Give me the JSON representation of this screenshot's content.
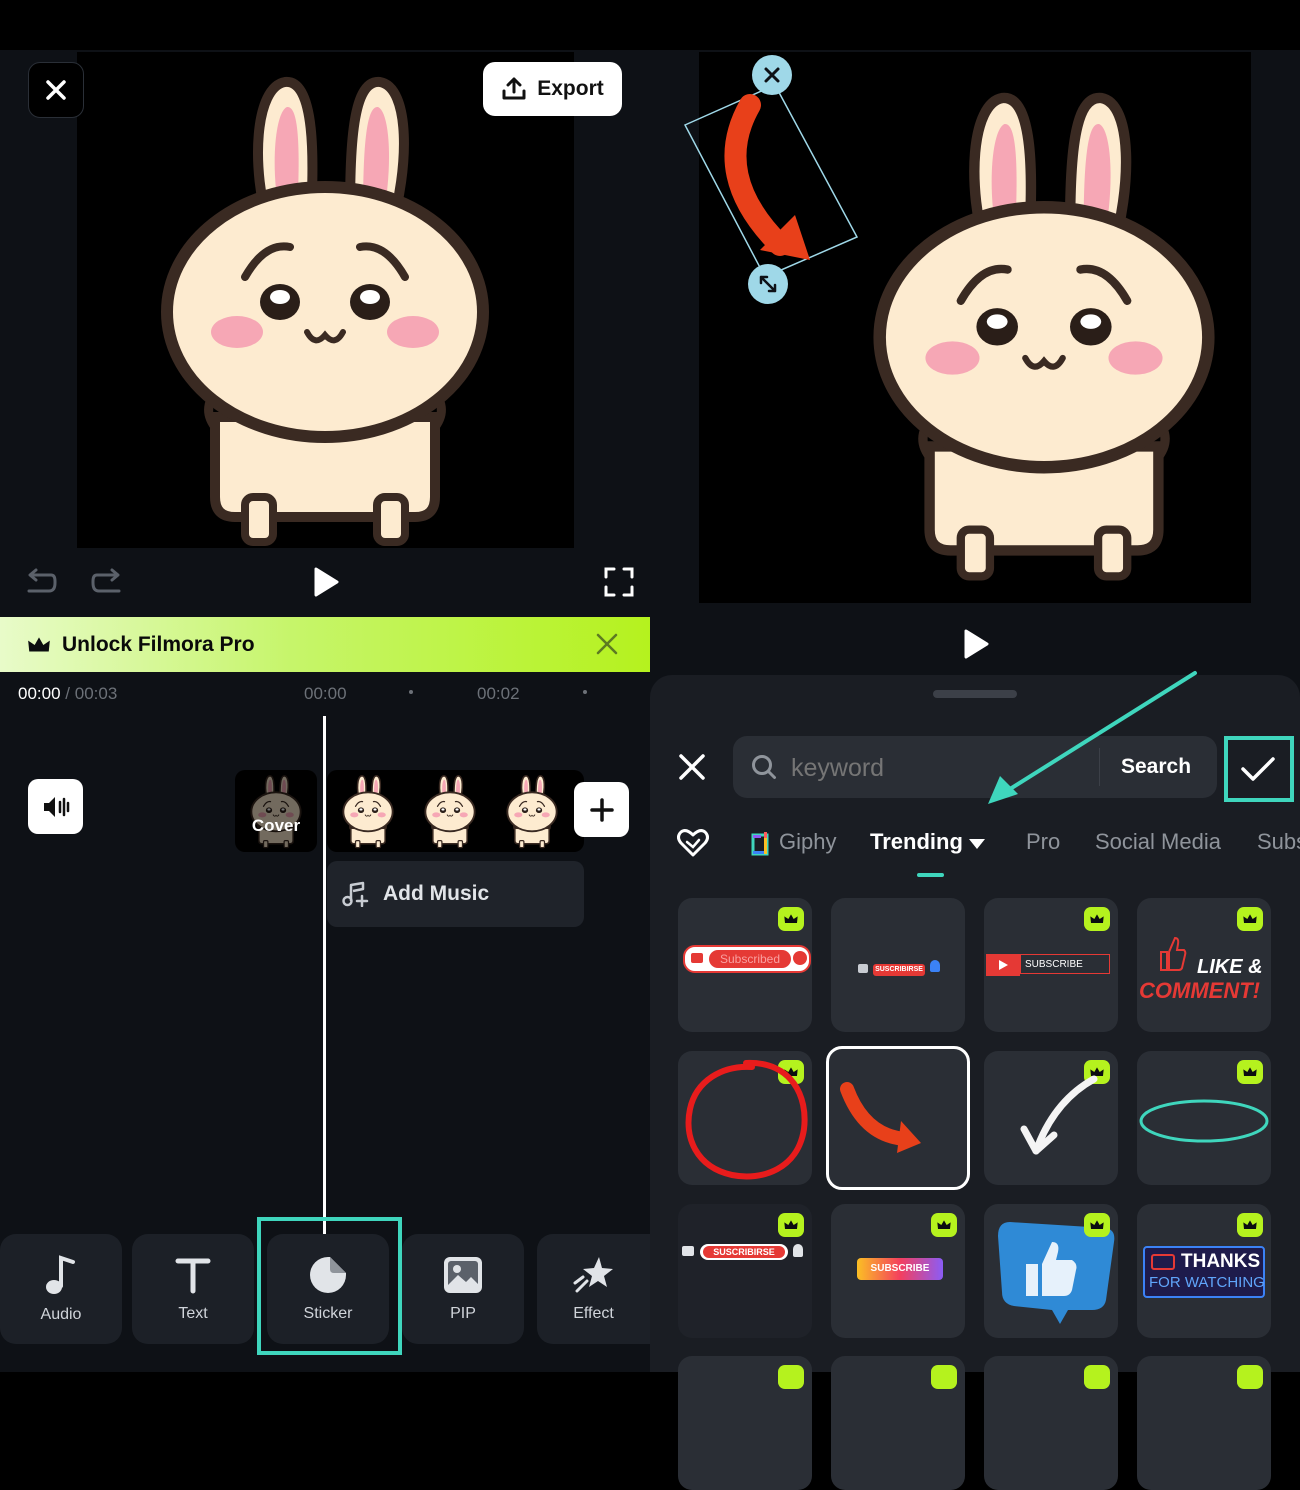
{
  "left_editor": {
    "export_label": "Export",
    "unlock_label": "Unlock Filmora Pro",
    "time_current": "00:00",
    "time_separator": "/",
    "time_total": "00:03",
    "ruler_0": "00:00",
    "ruler_1": "00:02",
    "cover_label": "Cover",
    "add_music_label": "Add Music",
    "tools": [
      {
        "label": "Audio",
        "icon": "music-note-icon"
      },
      {
        "label": "Text",
        "icon": "text-icon"
      },
      {
        "label": "Sticker",
        "icon": "sticker-icon"
      },
      {
        "label": "PIP",
        "icon": "image-icon"
      },
      {
        "label": "Effect",
        "icon": "star-burst-icon"
      }
    ]
  },
  "sticker_panel": {
    "search_placeholder": "keyword",
    "search_button": "Search",
    "categories": [
      "Giphy",
      "Trending",
      "Pro",
      "Social Media",
      "Subs"
    ],
    "active_category": "Trending",
    "stickers": [
      {
        "text": "Subscribed"
      },
      {
        "text": "SUSCRIBIRSE"
      },
      {
        "text": "SUBSCRIBE"
      },
      {
        "text_line1": "LIKE &",
        "text_line2": "COMMENT!"
      },
      {
        "text": ""
      },
      {
        "text": ""
      },
      {
        "text": ""
      },
      {
        "text": ""
      },
      {
        "text": "SUSCRIBIRSE"
      },
      {
        "text": "SUBSCRIBE"
      },
      {
        "text": ""
      },
      {
        "text_line1": "THANKS",
        "text_line2": "FOR WATCHING"
      }
    ]
  },
  "colors": {
    "accent_teal": "#3fd6bd",
    "pro_green": "#b5f21e",
    "sheet_bg": "#1a1d23",
    "arrow_red": "#e8401a"
  }
}
